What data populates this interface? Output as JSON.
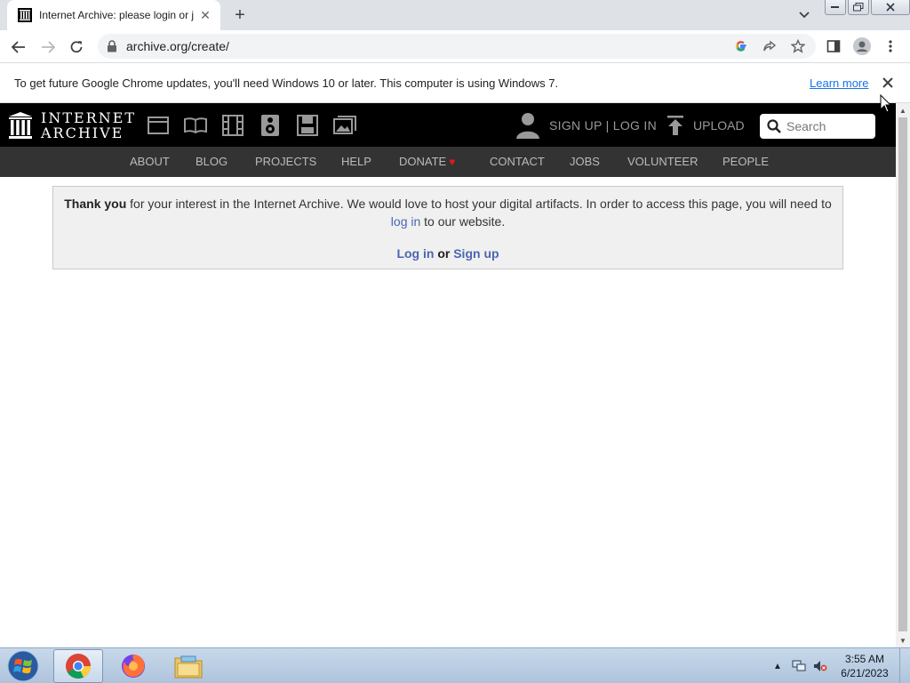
{
  "browser": {
    "tab": {
      "title": "Internet Archive: please login or j",
      "close_glyph": "✕"
    },
    "new_tab_glyph": "+",
    "address": {
      "url": "archive.org/create/"
    },
    "infobar": {
      "message": "To get future Google Chrome updates, you'll need Windows 10 or later. This computer is using Windows 7.",
      "learn_more": "Learn more"
    }
  },
  "ia": {
    "logo": {
      "line1": "INTERNET",
      "line2": "ARCHIVE"
    },
    "media_icons": [
      "web-icon",
      "texts-icon",
      "video-icon",
      "audio-icon",
      "software-icon",
      "images-icon"
    ],
    "account": {
      "signup_login": "SIGN UP | LOG IN"
    },
    "upload": {
      "label": "UPLOAD"
    },
    "search": {
      "placeholder": "Search"
    },
    "subnav": {
      "about": "ABOUT",
      "blog": "BLOG",
      "projects": "PROJECTS",
      "help": "HELP",
      "donate": "DONATE",
      "donate_heart": "♥",
      "contact": "CONTACT",
      "jobs": "JOBS",
      "volunteer": "VOLUNTEER",
      "people": "PEOPLE"
    },
    "notice": {
      "bold_intro": "Thank you",
      "text_part1": " for your interest in the Internet Archive. We would love to host your digital artifacts. In order to access this page, you will need to",
      "login_link": "log in",
      "text_part2": " to our website.",
      "login_button": "Log in",
      "or_text": " or ",
      "signup_button": "Sign up"
    }
  },
  "taskbar": {
    "apps": [
      "chrome-icon",
      "firefox-icon",
      "file-explorer-icon"
    ],
    "clock": {
      "time": "3:55 AM",
      "date": "6/21/2023"
    }
  },
  "colors": {
    "ia_black": "#000000",
    "ia_subnav": "#333333",
    "link_blue": "#4a66b1",
    "donate_heart": "#e21a1a",
    "chrome_link": "#1a73e8"
  }
}
